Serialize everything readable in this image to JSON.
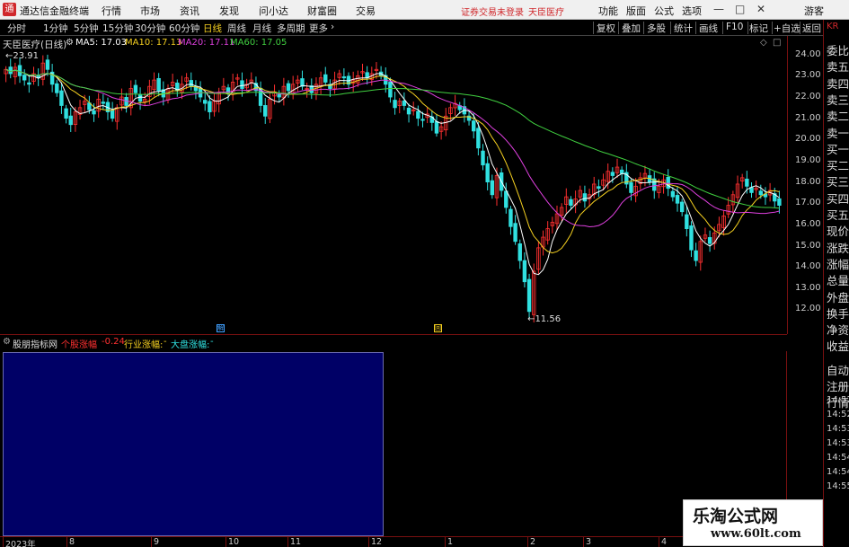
{
  "app": {
    "title": "通达信金融终端",
    "logo": "通",
    "menus": [
      "行情",
      "市场",
      "资讯",
      "发现",
      "问小达",
      "财富圈",
      "交易"
    ],
    "login_status": "证券交易未登录",
    "stock_title": "天臣医疗",
    "top_right_menus": [
      "功能",
      "版面",
      "公式",
      "选项"
    ],
    "guest": "游客",
    "window_controls": [
      "minimize-icon",
      "maximize-icon",
      "close-icon"
    ]
  },
  "periods": [
    "分时",
    "1分钟",
    "5分钟",
    "15分钟",
    "30分钟",
    "60分钟",
    "日线",
    "周线",
    "月线",
    "多周期",
    "更多"
  ],
  "active_period": "日线",
  "right_tools": [
    "复权",
    "叠加",
    "多股",
    "统计",
    "画线",
    "F10",
    "标记",
    "+自选",
    "返回"
  ],
  "chart": {
    "stock_label": "天臣医疗(日线)",
    "ma5": "MA5: 17.03",
    "ma10": "MA10: 17.13",
    "ma20": "MA20: 17.11",
    "ma60": "MA60: 17.05",
    "high_label": "23.91",
    "low_label": "11.56",
    "marker1": "解",
    "marker2": "回",
    "colors": {
      "ma5": "#ffffff",
      "ma10": "#f5d020",
      "ma20": "#e040e0",
      "ma60": "#40d040",
      "up": "#ff3030",
      "down": "#30e0e0"
    }
  },
  "chart_data": {
    "type": "candlestick",
    "title": "天臣医疗(日线)",
    "y_ticks": [
      "24.00",
      "23.00",
      "22.00",
      "21.00",
      "20.00",
      "19.00",
      "18.00",
      "17.00",
      "16.00",
      "15.00",
      "14.00",
      "13.00",
      "12.00"
    ],
    "ylim": [
      11.3,
      24.2
    ],
    "x_ticks": [
      "2023年",
      "8",
      "9",
      "10",
      "11",
      "12",
      "1",
      "2",
      "3",
      "4"
    ],
    "close": [
      23.3,
      23.1,
      23.4,
      23.0,
      22.8,
      22.6,
      23.1,
      22.9,
      23.6,
      23.3,
      22.6,
      22.2,
      21.6,
      21.0,
      20.7,
      21.3,
      21.5,
      21.8,
      21.4,
      21.2,
      21.9,
      21.7,
      21.3,
      21.0,
      21.5,
      22.0,
      21.6,
      22.4,
      22.2,
      21.8,
      21.9,
      22.5,
      22.8,
      22.3,
      22.0,
      22.4,
      22.7,
      22.3,
      22.6,
      22.9,
      22.5,
      22.3,
      22.0,
      21.7,
      21.3,
      21.8,
      22.2,
      22.5,
      22.2,
      22.7,
      22.9,
      22.4,
      22.6,
      22.8,
      22.3,
      21.6,
      21.1,
      21.9,
      22.2,
      22.0,
      22.5,
      22.3,
      22.6,
      22.8,
      22.5,
      22.4,
      22.2,
      22.6,
      22.9,
      22.7,
      22.4,
      22.8,
      23.1,
      22.9,
      22.6,
      22.8,
      23.0,
      23.2,
      22.9,
      23.1,
      23.3,
      23.0,
      22.6,
      22.0,
      21.5,
      21.8,
      21.6,
      21.2,
      21.4,
      21.0,
      20.9,
      21.2,
      20.8,
      20.3,
      20.6,
      21.1,
      21.5,
      21.7,
      21.4,
      21.2,
      20.9,
      20.4,
      19.6,
      18.8,
      18.0,
      17.4,
      18.3,
      17.6,
      16.8,
      15.9,
      15.2,
      14.3,
      13.3,
      11.9,
      13.8,
      14.9,
      15.4,
      15.8,
      16.1,
      16.5,
      16.8,
      17.3,
      16.9,
      17.2,
      17.6,
      17.1,
      17.4,
      17.9,
      17.7,
      18.1,
      18.5,
      18.3,
      18.7,
      18.4,
      17.9,
      17.5,
      17.8,
      18.2,
      18.4,
      18.0,
      17.6,
      17.8,
      18.1,
      17.7,
      17.3,
      17.0,
      16.6,
      15.8,
      14.8,
      14.3,
      15.2,
      15.5,
      15.1,
      15.6,
      16.0,
      16.4,
      16.9,
      17.4,
      17.9,
      18.2,
      17.8,
      17.5,
      17.7,
      17.4,
      17.3,
      17.6,
      17.1,
      16.9
    ],
    "ma_values": {
      "MA5": 17.03,
      "MA10": 17.13,
      "MA20": 17.11,
      "MA60": 17.05
    },
    "high": 23.91,
    "low": 11.56
  },
  "indicator": {
    "name": "股朋指标网",
    "stock_change_label": "个股涨幅",
    "stock_change_value": "-0.24",
    "industry_label": "行业涨幅:",
    "industry_value": "-",
    "market_label": "大盘涨幅:",
    "market_value": "-"
  },
  "right_panel": {
    "head": "KR",
    "labels": [
      "委比",
      "卖五",
      "卖四",
      "卖三",
      "卖二",
      "卖一",
      "买一",
      "买二",
      "买三",
      "买四",
      "买五",
      "现价",
      "涨跌",
      "涨幅",
      "总量",
      "外盘",
      "换手",
      "净资",
      "收益",
      "自动",
      "注册",
      "行情"
    ],
    "times": [
      "14:52",
      "14:52",
      "14:53",
      "14:53",
      "14:54",
      "14:54",
      "14:55"
    ]
  },
  "watermark": {
    "title": "乐淘公式网",
    "url": "www.60lt.com"
  }
}
